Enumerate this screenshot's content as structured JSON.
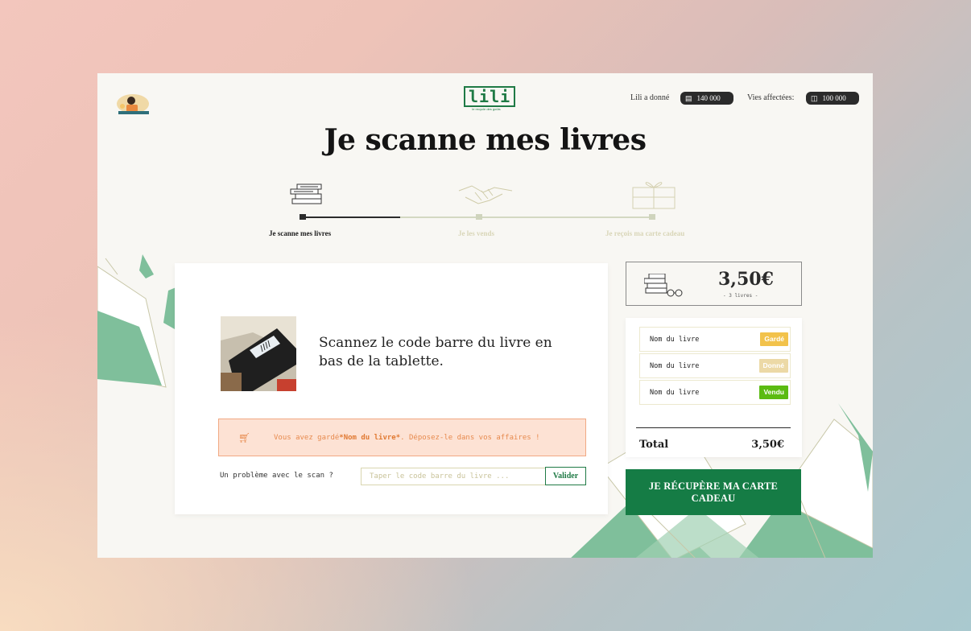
{
  "header": {
    "logo_text": "lili",
    "logo_tagline": "le recycle des goûts",
    "donated_label": "Lili a donné",
    "donated_value": "140 000",
    "donated_icon": "book-icon",
    "lives_label": "Vies affectées:",
    "lives_value": "100 000",
    "lives_icon": "chair-icon"
  },
  "title": "Je scanne mes livres",
  "steps": [
    {
      "label": "Je scanne mes livres",
      "icon": "books-icon",
      "active": true
    },
    {
      "label": "Je les vends",
      "icon": "handshake-icon",
      "active": false
    },
    {
      "label": "Je reçois ma carte cadeau",
      "icon": "gift-icon",
      "active": false
    }
  ],
  "scan": {
    "instruction": "Scannez le code barre du livre en bas de la tablette.",
    "alert_prefix": "Vous avez gardé ",
    "alert_book": "*Nom du livre*",
    "alert_suffix": ". Déposez-le dans vos affaires !",
    "alert_icon": "cart-icon",
    "problem_label": "Un problème avec le scan ?",
    "input_placeholder": "Taper le code barre du livre ...",
    "validate_label": "Valider"
  },
  "summary": {
    "amount": "3,50€",
    "count": "- 3 livres -",
    "books": [
      {
        "name": "Nom du livre",
        "status": "Gardé",
        "color": "#f2c24b"
      },
      {
        "name": "Nom du livre",
        "status": "Donné",
        "color": "#ecd9a6"
      },
      {
        "name": "Nom du livre",
        "status": "Vendu",
        "color": "#5bbb12"
      }
    ],
    "total_label": "Total",
    "total_value": "3,50€"
  },
  "cta_label": "JE RÉCUPÈRE MA CARTE CADEAU",
  "colors": {
    "accent_green": "#157c45",
    "alert_bg": "#fde2d4",
    "alert_text": "#e78a4e",
    "page_bg": "#f8f7f3"
  }
}
